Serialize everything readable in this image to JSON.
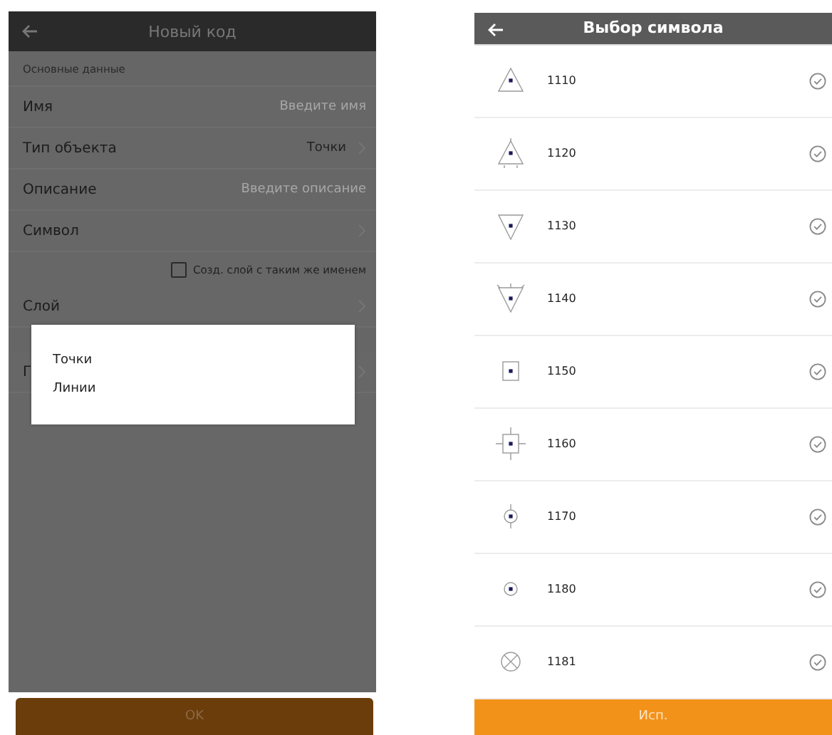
{
  "new_code_screen": {
    "title": "Новый код",
    "section": "Основные данные",
    "fields": [
      {
        "kind": "input",
        "label": "Имя",
        "placeholder": "Введите имя"
      },
      {
        "kind": "select",
        "label": "Тип объекта",
        "value": "Точки"
      },
      {
        "kind": "input",
        "label": "Описание",
        "placeholder": "Введите описание"
      },
      {
        "kind": "nav",
        "label": "Символ"
      },
      {
        "kind": "checkbox",
        "label": "Созд. слой с таким же именем",
        "checked": false
      },
      {
        "kind": "nav",
        "label": "Слой"
      }
    ],
    "covered_row": {
      "label": "Г"
    },
    "popup": {
      "options": [
        "Точки",
        "Линии"
      ]
    },
    "ok_button": "OK"
  },
  "symbol_screen": {
    "title": "Выбор символа",
    "symbols": [
      {
        "kind": "triangle-up",
        "code": "1110"
      },
      {
        "kind": "triangle-up-ticks",
        "code": "1120"
      },
      {
        "kind": "triangle-down",
        "code": "1130"
      },
      {
        "kind": "triangle-down-ticks",
        "code": "1140"
      },
      {
        "kind": "square",
        "code": "1150"
      },
      {
        "kind": "square-ticks",
        "code": "1160"
      },
      {
        "kind": "circle-ticks",
        "code": "1170"
      },
      {
        "kind": "circle",
        "code": "1180"
      },
      {
        "kind": "circle-cross",
        "code": "1181"
      }
    ],
    "use_button": "Исп."
  }
}
